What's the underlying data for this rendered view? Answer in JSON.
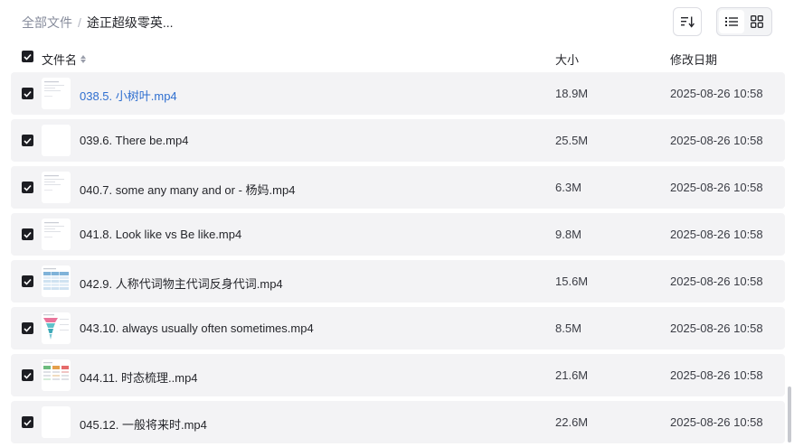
{
  "breadcrumb": {
    "root": "全部文件",
    "separator": "/",
    "current": "途正超级零英..."
  },
  "toolbar": {
    "sort_icon": "sort-icon",
    "view_list_icon": "list-view-icon",
    "view_grid_icon": "grid-view-icon",
    "active_view": "list"
  },
  "table": {
    "columns": {
      "name": "文件名",
      "size": "大小",
      "modified": "修改日期"
    },
    "rows": [
      {
        "name": "038.5. 小树叶.mp4",
        "size": "18.9M",
        "modified": "2025-08-26 10:58",
        "checked": true,
        "highlight": true,
        "thumb": "doc"
      },
      {
        "name": "039.6. There be.mp4",
        "size": "25.5M",
        "modified": "2025-08-26 10:58",
        "checked": true,
        "highlight": false,
        "thumb": "blank"
      },
      {
        "name": "040.7. some any many and or - 杨妈.mp4",
        "size": "6.3M",
        "modified": "2025-08-26 10:58",
        "checked": true,
        "highlight": false,
        "thumb": "doc"
      },
      {
        "name": "041.8. Look like vs Be like.mp4",
        "size": "9.8M",
        "modified": "2025-08-26 10:58",
        "checked": true,
        "highlight": false,
        "thumb": "doc"
      },
      {
        "name": "042.9. 人称代词物主代词反身代词.mp4",
        "size": "15.6M",
        "modified": "2025-08-26 10:58",
        "checked": true,
        "highlight": false,
        "thumb": "table"
      },
      {
        "name": "043.10. always usually often sometimes.mp4",
        "size": "8.5M",
        "modified": "2025-08-26 10:58",
        "checked": true,
        "highlight": false,
        "thumb": "funnel"
      },
      {
        "name": "044.11. 时态梳理..mp4",
        "size": "21.6M",
        "modified": "2025-08-26 10:58",
        "checked": true,
        "highlight": false,
        "thumb": "grid"
      },
      {
        "name": "045.12. 一般将来时.mp4",
        "size": "22.6M",
        "modified": "2025-08-26 10:58",
        "checked": true,
        "highlight": false,
        "thumb": "blank"
      }
    ]
  },
  "colors": {
    "link": "#2f6fd0",
    "row_bg": "#f3f3f5",
    "checkbox": "#1d1e23"
  }
}
